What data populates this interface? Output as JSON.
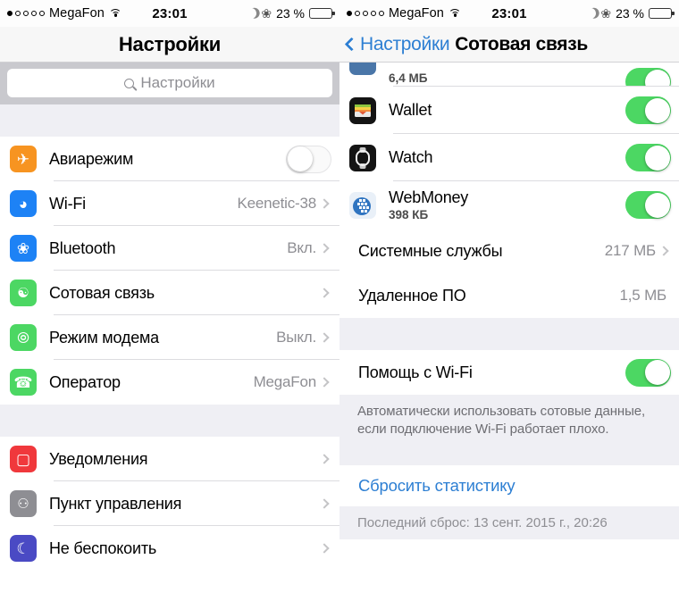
{
  "status_bar": {
    "signal_dots_filled": 1,
    "signal_dots_total": 5,
    "carrier": "MegaFon",
    "wifi_icon": "wifi-icon",
    "time": "23:01",
    "moon_icon": "do-not-disturb-moon-icon",
    "bluetooth_icon": "bluetooth-icon",
    "battery_percent": "23 %",
    "battery_level": 23
  },
  "left_screen": {
    "title": "Настройки",
    "search": {
      "placeholder": "Настройки",
      "icon": "search-icon"
    },
    "group_one": [
      {
        "label": "Авиарежим",
        "icon": "airplane-icon",
        "control": "toggle",
        "toggle_on": false
      },
      {
        "label": "Wi-Fi",
        "icon": "wifi-icon",
        "value": "Keenetic-38",
        "control": "chevron"
      },
      {
        "label": "Bluetooth",
        "icon": "bluetooth-icon",
        "value": "Вкл.",
        "control": "chevron"
      },
      {
        "label": "Сотовая связь",
        "icon": "cellular-icon",
        "value": "",
        "control": "chevron"
      },
      {
        "label": "Режим модема",
        "icon": "personal-hotspot-icon",
        "value": "Выкл.",
        "control": "chevron"
      },
      {
        "label": "Оператор",
        "icon": "carrier-phone-icon",
        "value": "MegaFon",
        "control": "chevron"
      }
    ],
    "group_two": [
      {
        "label": "Уведомления",
        "icon": "notifications-icon",
        "control": "chevron"
      },
      {
        "label": "Пункт управления",
        "icon": "control-center-icon",
        "control": "chevron"
      },
      {
        "label": "Не беспокоить",
        "icon": "do-not-disturb-icon",
        "control": "chevron"
      }
    ]
  },
  "right_screen": {
    "back_label": "Настройки",
    "title": "Сотовая связь",
    "apps": [
      {
        "label": "",
        "sub": "6,4 МБ",
        "icon": "vk-app-icon",
        "toggle_on": true,
        "partial": true
      },
      {
        "label": "Wallet",
        "sub": "",
        "icon": "wallet-app-icon",
        "toggle_on": true
      },
      {
        "label": "Watch",
        "sub": "",
        "icon": "watch-app-icon",
        "toggle_on": true
      },
      {
        "label": "WebMoney",
        "sub": "398 КБ",
        "icon": "webmoney-app-icon",
        "toggle_on": true
      }
    ],
    "system_rows": [
      {
        "label": "Системные службы",
        "value": "217 МБ",
        "control": "chevron"
      },
      {
        "label": "Удаленное ПО",
        "value": "1,5 МБ",
        "control": "none"
      }
    ],
    "wifi_assist": {
      "label": "Помощь с Wi-Fi",
      "toggle_on": true
    },
    "wifi_assist_note": "Автоматически использовать сотовые данные, если подключение Wi-Fi работает плохо.",
    "reset_label": "Сбросить статистику",
    "reset_note": "Последний сброс: 13 сент. 2015 г., 20:26"
  },
  "colors": {
    "accent_blue": "#2d7fd3",
    "toggle_green": "#4cd763",
    "group_bg": "#efeff4",
    "secondary_text": "#8e8e93"
  }
}
